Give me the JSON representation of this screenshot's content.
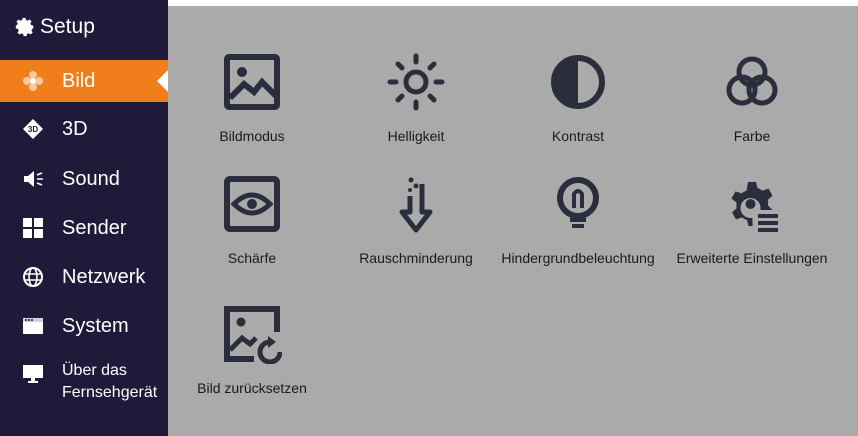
{
  "sidebar": {
    "title": "Setup",
    "items": [
      {
        "label": "Bild",
        "icon": "bild-icon",
        "active": true
      },
      {
        "label": "3D",
        "icon": "3d-icon"
      },
      {
        "label": "Sound",
        "icon": "speaker-icon"
      },
      {
        "label": "Sender",
        "icon": "grid-icon"
      },
      {
        "label": "Netzwerk",
        "icon": "globe-icon"
      },
      {
        "label": "System",
        "icon": "system-window-icon"
      },
      {
        "label_line1": "Über das",
        "label_line2": "Fernsehgerät",
        "icon": "monitor-icon"
      }
    ]
  },
  "tiles": [
    {
      "label": "Bildmodus",
      "icon": "image-icon"
    },
    {
      "label": "Helligkeit",
      "icon": "brightness-icon"
    },
    {
      "label": "Kontrast",
      "icon": "contrast-icon"
    },
    {
      "label": "Farbe",
      "icon": "color-circles-icon"
    },
    {
      "label": "Schärfe",
      "icon": "eye-frame-icon"
    },
    {
      "label": "Rauschminderung",
      "icon": "noise-reduction-icon"
    },
    {
      "label": "Hindergrundbeleuchtung",
      "icon": "lightbulb-icon"
    },
    {
      "label": "Erweiterte Einstellungen",
      "icon": "advanced-settings-icon"
    },
    {
      "label": "Bild zurücksetzen",
      "icon": "image-reset-icon"
    }
  ],
  "colors": {
    "sidebar_bg": "#1f1a3a",
    "active": "#f07f1b",
    "panel_bg": "#aaaaaa",
    "icon": "#2a2e3c"
  }
}
